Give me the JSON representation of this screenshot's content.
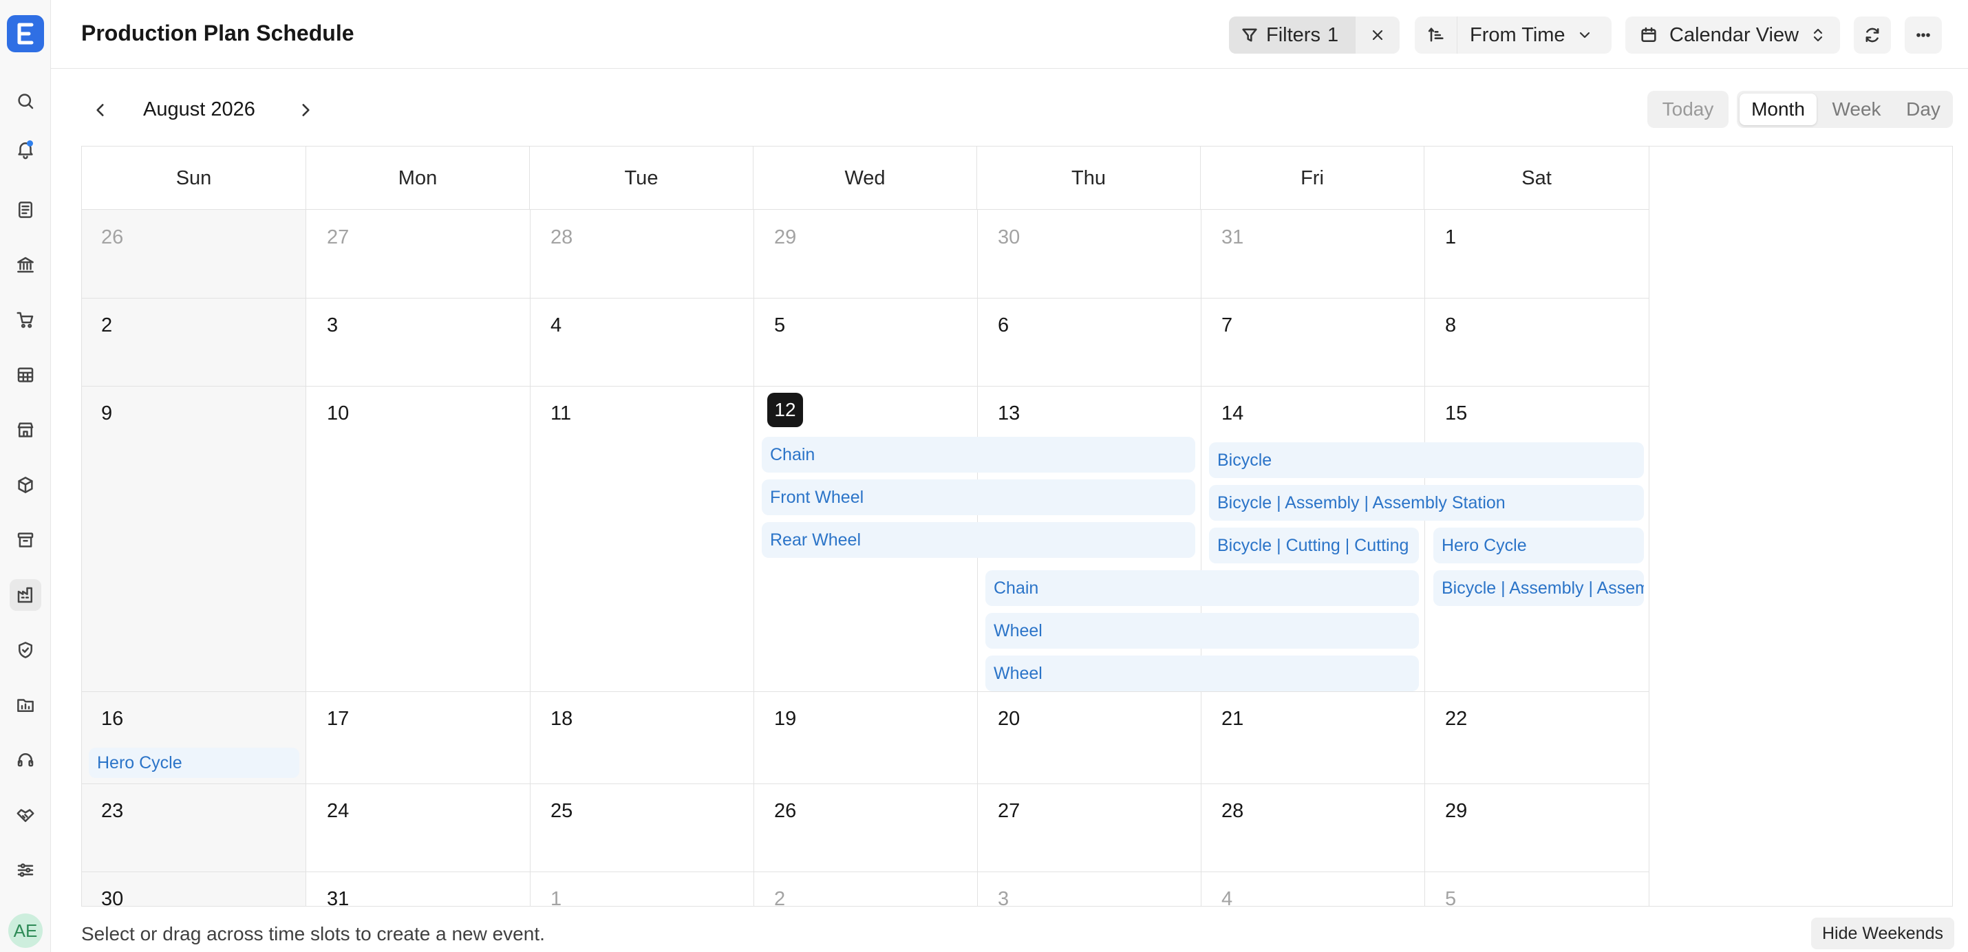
{
  "app": {
    "logo_letter": "E"
  },
  "header": {
    "title": "Production Plan Schedule",
    "filters_label": "Filters",
    "filters_count": "1",
    "sort_label": "From Time",
    "view_label": "Calendar View"
  },
  "toolbar": {
    "month_label": "August 2026",
    "today_label": "Today",
    "modes": [
      "Month",
      "Week",
      "Day"
    ],
    "selected_mode": "Month"
  },
  "calendar": {
    "weekdays": [
      "Sun",
      "Mon",
      "Tue",
      "Wed",
      "Thu",
      "Fri",
      "Sat"
    ],
    "weeks": [
      [
        {
          "d": "26",
          "muted": true
        },
        {
          "d": "27",
          "muted": true
        },
        {
          "d": "28",
          "muted": true
        },
        {
          "d": "29",
          "muted": true
        },
        {
          "d": "30",
          "muted": true
        },
        {
          "d": "31",
          "muted": true
        },
        {
          "d": "1"
        }
      ],
      [
        {
          "d": "2"
        },
        {
          "d": "3"
        },
        {
          "d": "4"
        },
        {
          "d": "5"
        },
        {
          "d": "6"
        },
        {
          "d": "7"
        },
        {
          "d": "8"
        }
      ],
      [
        {
          "d": "9"
        },
        {
          "d": "10"
        },
        {
          "d": "11"
        },
        {
          "d": "12",
          "today": true
        },
        {
          "d": "13"
        },
        {
          "d": "14"
        },
        {
          "d": "15"
        }
      ],
      [
        {
          "d": "16"
        },
        {
          "d": "17"
        },
        {
          "d": "18"
        },
        {
          "d": "19"
        },
        {
          "d": "20"
        },
        {
          "d": "21"
        },
        {
          "d": "22"
        }
      ],
      [
        {
          "d": "23"
        },
        {
          "d": "24"
        },
        {
          "d": "25"
        },
        {
          "d": "26"
        },
        {
          "d": "27"
        },
        {
          "d": "28"
        },
        {
          "d": "29"
        }
      ],
      [
        {
          "d": "30"
        },
        {
          "d": "31"
        },
        {
          "d": "1",
          "muted": true
        },
        {
          "d": "2",
          "muted": true
        },
        {
          "d": "3",
          "muted": true
        },
        {
          "d": "4",
          "muted": true
        },
        {
          "d": "5",
          "muted": true
        }
      ]
    ],
    "events": [
      "Chain",
      "Front Wheel",
      "Rear Wheel",
      "Bicycle",
      "Bicycle | Assembly | Assembly Station",
      "Bicycle | Cutting | Cutting",
      "Hero Cycle",
      "Bicycle | Assembly | Assembly",
      "Chain",
      "Wheel",
      "Wheel",
      "Hero Cycle"
    ]
  },
  "footer": {
    "hint": "Select or drag across time slots to create a new event.",
    "hide_weekends": "Hide Weekends"
  },
  "user": {
    "initials": "AE"
  },
  "colors": {
    "accent": "#2f6fe4",
    "event_bg": "#eef5fc",
    "event_text": "#2b74c8"
  }
}
